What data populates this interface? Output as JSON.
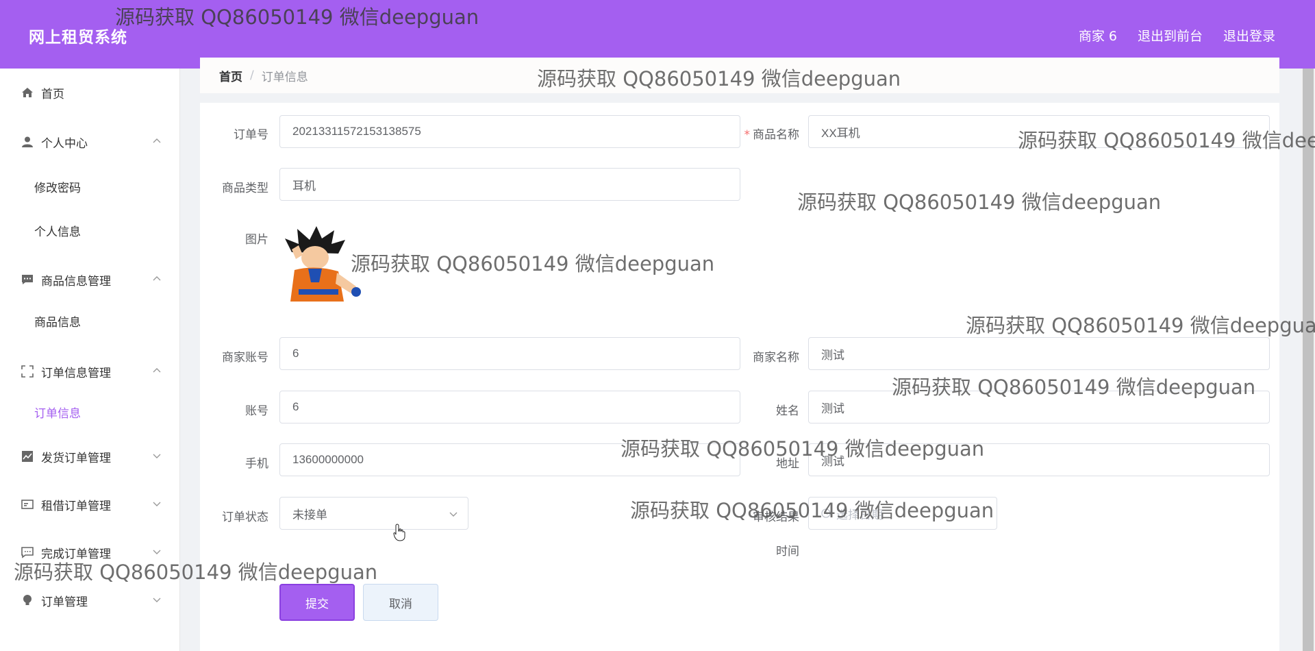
{
  "header": {
    "title": "网上租贸系统",
    "nav": [
      "商家 6",
      "退出到前台",
      "退出登录"
    ]
  },
  "sidebar": {
    "items": [
      {
        "label": "首页",
        "icon": "home-icon"
      },
      {
        "label": "个人中心",
        "icon": "user-icon",
        "expanded": true,
        "children": [
          "修改密码",
          "个人信息"
        ]
      },
      {
        "label": "商品信息管理",
        "icon": "chat-icon",
        "expanded": true,
        "children": [
          "商品信息"
        ]
      },
      {
        "label": "订单信息管理",
        "icon": "fullscreen-icon",
        "expanded": true,
        "children": [
          "订单信息"
        ]
      },
      {
        "label": "发货订单管理",
        "icon": "chart-icon",
        "expanded": false
      },
      {
        "label": "租借订单管理",
        "icon": "card-icon",
        "expanded": false
      },
      {
        "label": "完成订单管理",
        "icon": "comment-icon",
        "expanded": false
      },
      {
        "label": "订单管理",
        "icon": "bulb-icon",
        "expanded": false
      }
    ],
    "active_child": "订单信息"
  },
  "breadcrumb": {
    "home": "首页",
    "separator": "/",
    "current": "订单信息"
  },
  "form": {
    "order_no_label": "订单号",
    "order_no": "20213311572153138575",
    "product_name_label": "商品名称",
    "product_name": "XX耳机",
    "product_type_label": "商品类型",
    "product_type": "耳机",
    "image_label": "图片",
    "merchant_account_label": "商家账号",
    "merchant_account": "6",
    "merchant_name_label": "商家名称",
    "merchant_name": "测试",
    "account_label": "账号",
    "account": "6",
    "name_label": "姓名",
    "name": "测试",
    "phone_label": "手机",
    "phone": "13600000000",
    "address_label": "地址",
    "address": "测试",
    "status_label": "订单状态",
    "status_value": "未接单",
    "review_label": "审核结果",
    "date_placeholder": "选择日期",
    "time_label": "时间",
    "submit_label": "提交",
    "cancel_label": "取消"
  },
  "watermark": {
    "text": "源码获取 QQ86050149 微信deepguan"
  },
  "colors": {
    "accent": "#a45ff0",
    "required": "#f56c6c"
  }
}
